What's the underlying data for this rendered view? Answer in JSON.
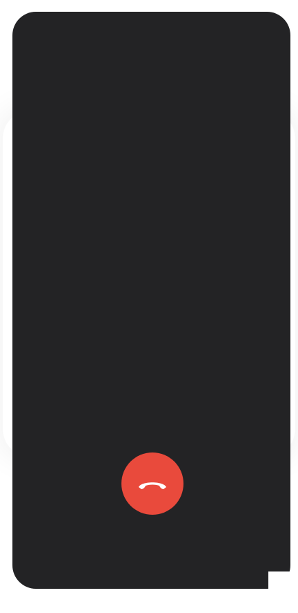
{
  "end_call": {
    "icon": "phone-hangup-icon",
    "color": "#e94a3c",
    "icon_color": "#ffffff"
  },
  "screen": {
    "background": "#232325"
  }
}
